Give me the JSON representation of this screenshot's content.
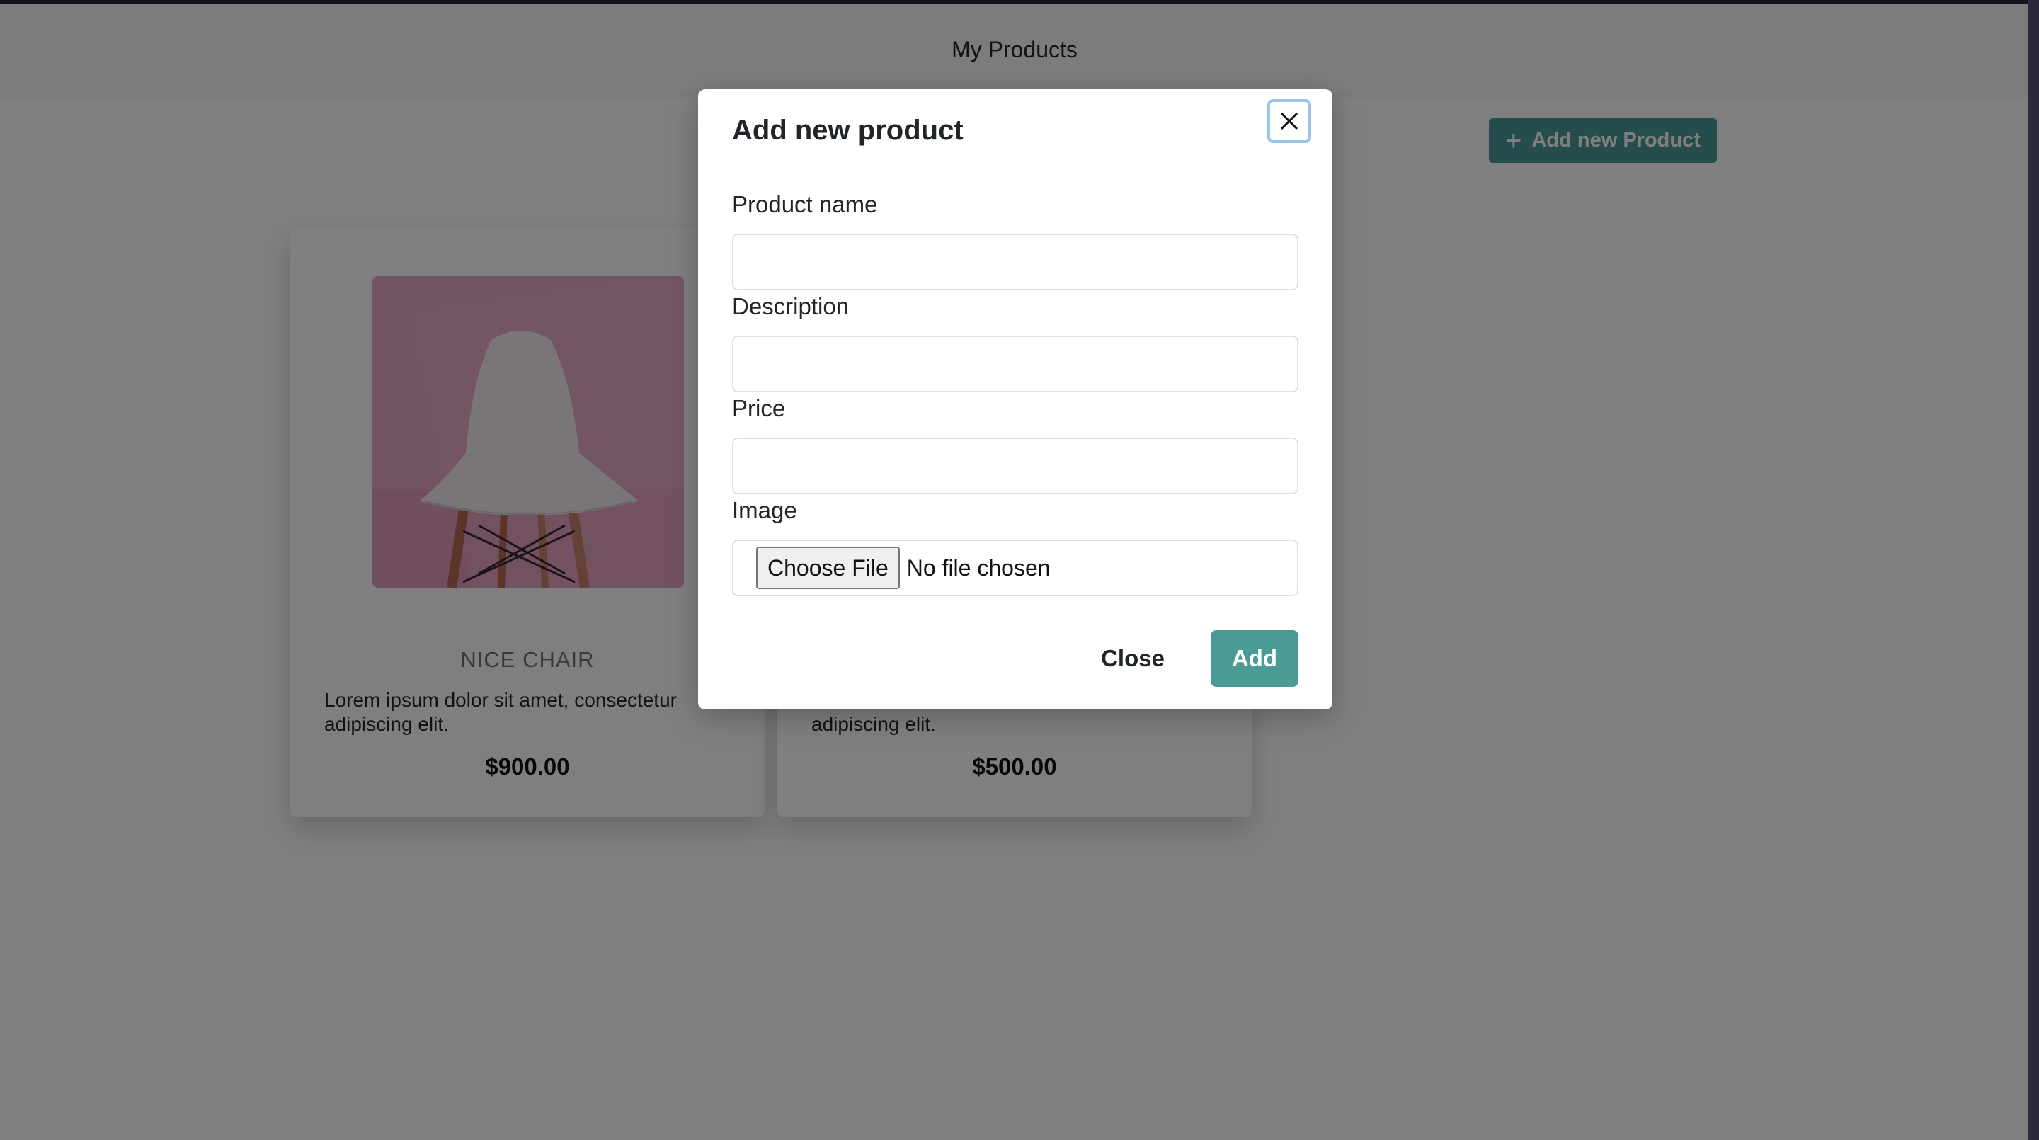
{
  "header": {
    "title": "My Products"
  },
  "toolbar": {
    "add_product_label": "Add new Product",
    "add_icon": "plus-icon"
  },
  "products": [
    {
      "name": "NICE CHAIR",
      "description": "Lorem ipsum dolor sit amet, consectetur adipiscing elit.",
      "price": "$900.00",
      "image": "chair-photo"
    },
    {
      "name": "",
      "description": "Lorem ipsum dolor sit amet, consectetur adipiscing elit.",
      "visible_description": "adipiscing elit.",
      "price": "$500.00"
    }
  ],
  "modal": {
    "title": "Add new product",
    "close_icon": "close-icon",
    "fields": {
      "product_name": {
        "label": "Product name",
        "value": ""
      },
      "description": {
        "label": "Description",
        "value": ""
      },
      "price": {
        "label": "Price",
        "value": ""
      },
      "image": {
        "label": "Image",
        "button_label": "Choose File",
        "file_status": "No file chosen"
      }
    },
    "close_label": "Close",
    "add_label": "Add"
  },
  "colors": {
    "accent": "#4a9a96",
    "focus_ring": "#9cc3e8",
    "chair_background": "#e5a9c4"
  }
}
